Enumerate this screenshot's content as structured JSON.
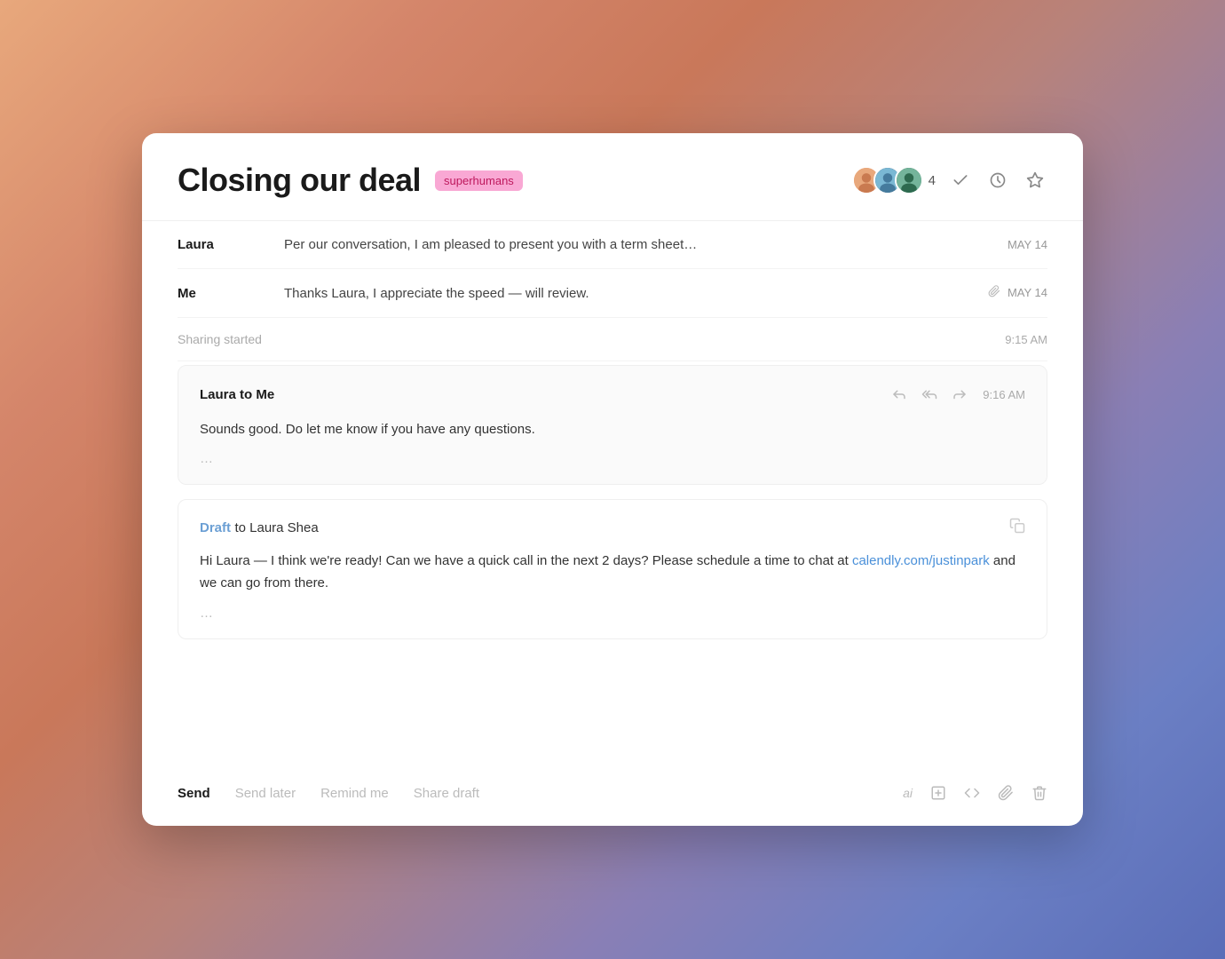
{
  "header": {
    "title": "Closing our deal",
    "tag": "superhumans",
    "participant_count": "4"
  },
  "email_threads": [
    {
      "sender": "Laura",
      "snippet": "Per our conversation, I am pleased to present you with a term sheet…",
      "date": "MAY 14",
      "has_attachment": false
    },
    {
      "sender": "Me",
      "snippet": "Thanks Laura, I appreciate the speed — will review.",
      "date": "MAY 14",
      "has_attachment": true
    }
  ],
  "sharing": {
    "label": "Sharing started",
    "time": "9:15 AM"
  },
  "expanded_email": {
    "from": "Laura to Me",
    "time": "9:16 AM",
    "body": "Sounds good.  Do let me know if you have any questions.",
    "ellipsis": "…"
  },
  "draft": {
    "label": "Draft",
    "to": "to Laura Shea",
    "body_start": "Hi Laura — I think we're ready! Can we have a quick call in the next 2 days? Please schedule a time to chat at ",
    "link_text": "calendly.com/justinpark",
    "link_href": "https://calendly.com/justinpark",
    "body_end": " and we can go from there.",
    "ellipsis": "…"
  },
  "toolbar": {
    "send_label": "Send",
    "send_later_label": "Send later",
    "remind_me_label": "Remind me",
    "share_draft_label": "Share draft",
    "ai_label": "ai"
  }
}
